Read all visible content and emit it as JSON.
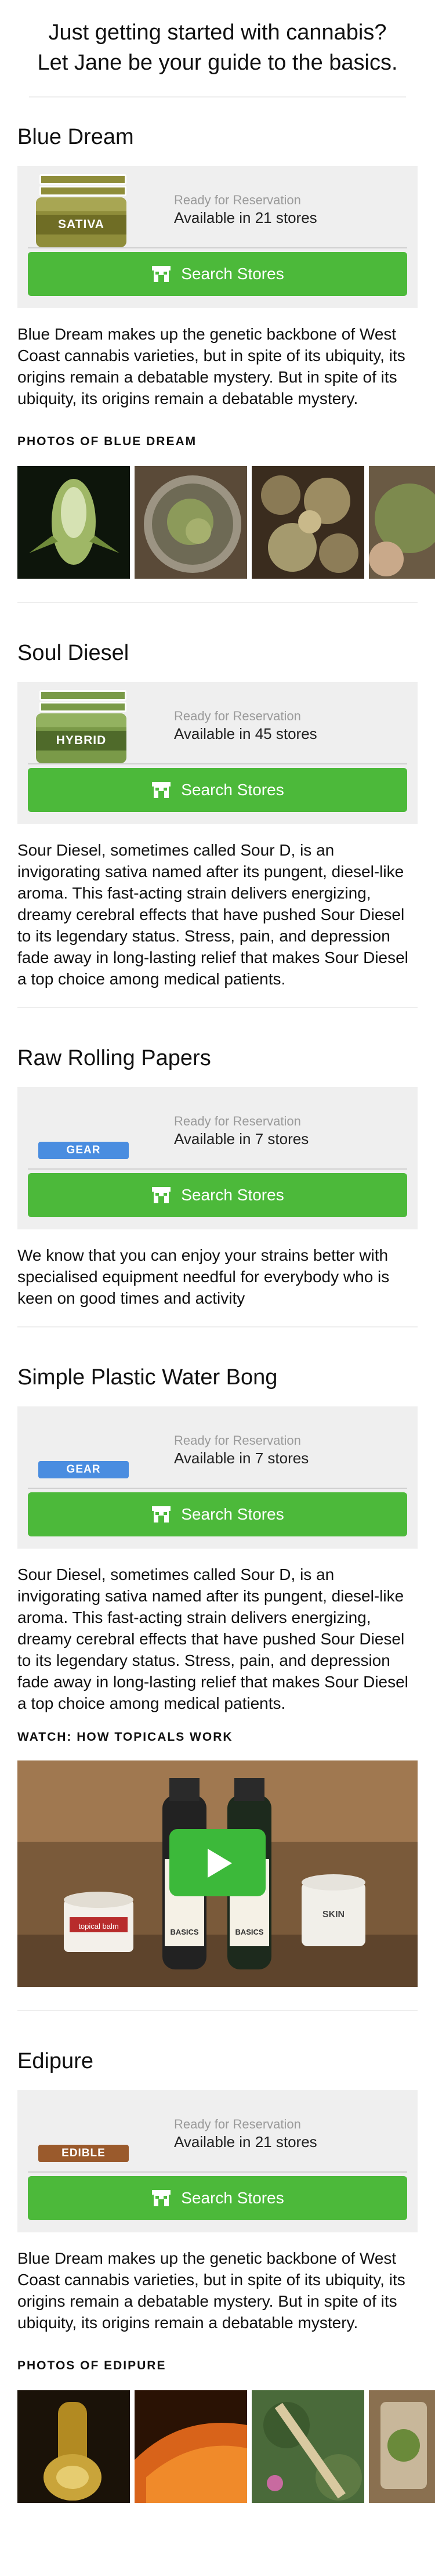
{
  "intro": {
    "line1": "Just getting started with cannabis?",
    "line2": "Let Jane be your guide to the basics."
  },
  "ui": {
    "ready_label": "Ready for Reservation",
    "search_label": "Search Stores",
    "store_icon": "store-icon",
    "play_icon": "play-icon"
  },
  "colors": {
    "green": "#4cb93a",
    "sativa": "#8f8d3a",
    "hybrid": "#7a9a48",
    "gear": "#4a8de0",
    "edible": "#9a5a2c"
  },
  "sections": [
    {
      "title": "Blue Dream",
      "badge": "SATIVA",
      "availability": "Available in 21 stores",
      "description": "Blue Dream makes up the genetic backbone of West Coast cannabis varieties, but in spite of its ubiquity, its origins remain a debatable mystery. But in spite of its ubiquity, its origins remain a debatable mystery.",
      "media_heading": "PHOTOS OF BLUE DREAM"
    },
    {
      "title": "Soul Diesel",
      "badge": "HYBRID",
      "availability": "Available in 45 stores",
      "description": "Sour Diesel, sometimes called Sour D, is an invigorating sativa named after its pungent, diesel-like aroma. This fast-acting strain delivers energizing, dreamy cerebral effects that have pushed Sour Diesel to its legendary status. Stress, pain, and depression fade away in long-lasting relief that makes Sour Diesel a top choice among medical patients."
    },
    {
      "title": "Raw Rolling Papers",
      "badge": "GEAR",
      "availability": "Available in 7 stores",
      "description": "We know that you can enjoy your strains better with specialised equipment needful for everybody who is keen on good times and activity"
    },
    {
      "title": "Simple Plastic Water Bong",
      "badge": "GEAR",
      "availability": "Available in 7 stores",
      "description": "Sour Diesel, sometimes called Sour D, is an invigorating sativa named after its pungent, diesel-like aroma. This fast-acting strain delivers energizing, dreamy cerebral effects that have pushed Sour Diesel to its legendary status. Stress, pain, and depression fade away in long-lasting relief that makes Sour Diesel a top choice among medical patients.",
      "media_heading": "WATCH: HOW TOPICALS WORK",
      "video_labels": {
        "jar_left": "topical balm",
        "bottle_text": "BASICS",
        "jar_right": "SKIN"
      }
    },
    {
      "title": "Edipure",
      "badge": "EDIBLE",
      "availability": "Available in 21 stores",
      "description": "Blue Dream makes up the genetic backbone of West Coast cannabis varieties, but in spite of its ubiquity, its origins remain a debatable mystery. But in spite of its ubiquity, its origins remain a debatable mystery.",
      "media_heading": "PHOTOS OF EDIPURE"
    }
  ]
}
